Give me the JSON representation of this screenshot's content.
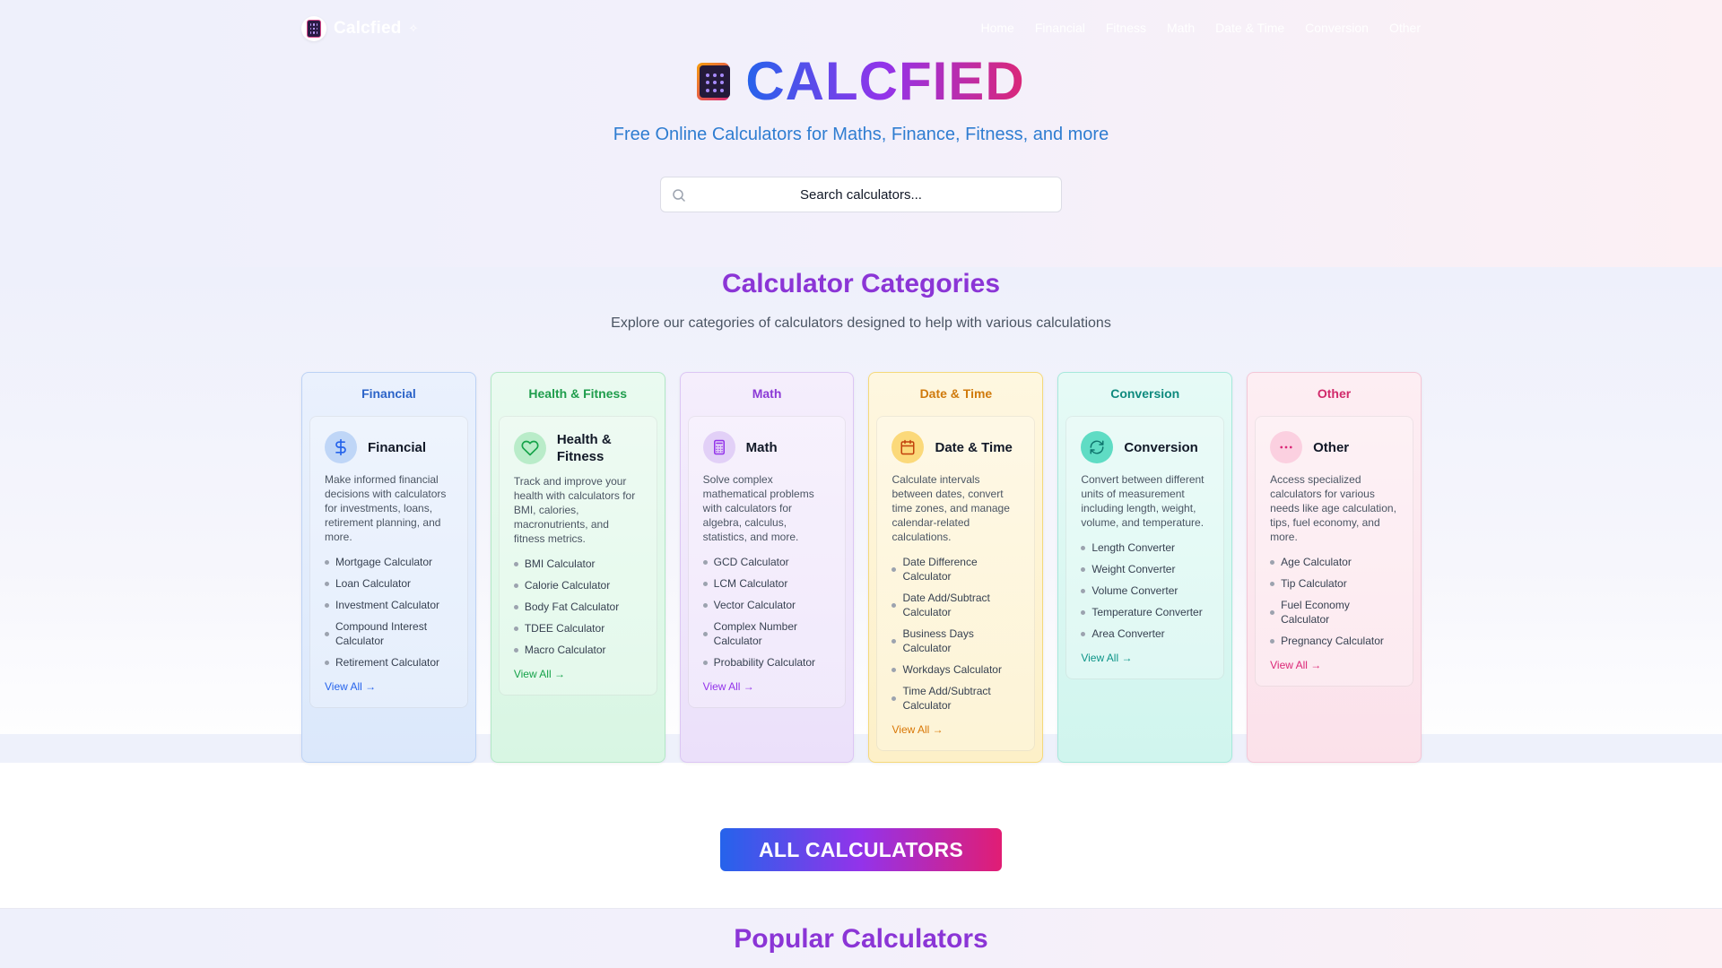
{
  "nav": {
    "brand": "Calcfied",
    "brand_spark": "✧",
    "links": [
      "Home",
      "Financial",
      "Fitness",
      "Math",
      "Date & Time",
      "Conversion",
      "Other"
    ]
  },
  "hero": {
    "title": "CALCFIED",
    "subtitle": "Free Online Calculators for Maths, Finance, Fitness, and more",
    "search_placeholder": "Search calculators..."
  },
  "categories": {
    "title": "Calculator Categories",
    "subtitle": "Explore our categories of calculators designed to help with various calculations",
    "cards": [
      {
        "header": "Financial",
        "name": "Financial",
        "icon": "dollar-icon",
        "accent": "#2563eb",
        "desc": "Make informed financial decisions with calculators for investments, loans, retirement planning, and more.",
        "items": [
          "Mortgage Calculator",
          "Loan Calculator",
          "Investment Calculator",
          "Compound Interest Calculator",
          "Retirement Calculator"
        ],
        "view_all": "View All →"
      },
      {
        "header": "Health & Fitness",
        "name": "Health & Fitness",
        "icon": "heart-icon",
        "accent": "#16a34a",
        "desc": "Track and improve your health with calculators for BMI, calories, macronutrients, and fitness metrics.",
        "items": [
          "BMI Calculator",
          "Calorie Calculator",
          "Body Fat Calculator",
          "TDEE Calculator",
          "Macro Calculator"
        ],
        "view_all": "View All →"
      },
      {
        "header": "Math",
        "name": "Math",
        "icon": "calculator-icon",
        "accent": "#9333ea",
        "desc": "Solve complex mathematical problems with calculators for algebra, calculus, statistics, and more.",
        "items": [
          "GCD Calculator",
          "LCM Calculator",
          "Vector Calculator",
          "Complex Number Calculator",
          "Probability Calculator"
        ],
        "view_all": "View All →"
      },
      {
        "header": "Date & Time",
        "name": "Date & Time",
        "icon": "calendar-icon",
        "accent": "#d97706",
        "desc": "Calculate intervals between dates, convert time zones, and manage calendar-related calculations.",
        "items": [
          "Date Difference Calculator",
          "Date Add/Subtract Calculator",
          "Business Days Calculator",
          "Workdays Calculator",
          "Time Add/Subtract Calculator"
        ],
        "view_all": "View All →"
      },
      {
        "header": "Conversion",
        "name": "Conversion",
        "icon": "refresh-icon",
        "accent": "#0d9488",
        "desc": "Convert between different units of measurement including length, weight, volume, and temperature.",
        "items": [
          "Length Converter",
          "Weight Converter",
          "Volume Converter",
          "Temperature Converter",
          "Area Converter"
        ],
        "view_all": "View All →"
      },
      {
        "header": "Other",
        "name": "Other",
        "icon": "more-horizontal-icon",
        "accent": "#db2777",
        "desc": "Access specialized calculators for various needs like age calculation, tips, fuel economy, and more.",
        "items": [
          "Age Calculator",
          "Tip Calculator",
          "Fuel Economy Calculator",
          "Pregnancy Calculator"
        ],
        "view_all": "View All →"
      }
    ]
  },
  "all_button": "ALL CALCULATORS",
  "popular": {
    "title": "Popular Calculators"
  }
}
